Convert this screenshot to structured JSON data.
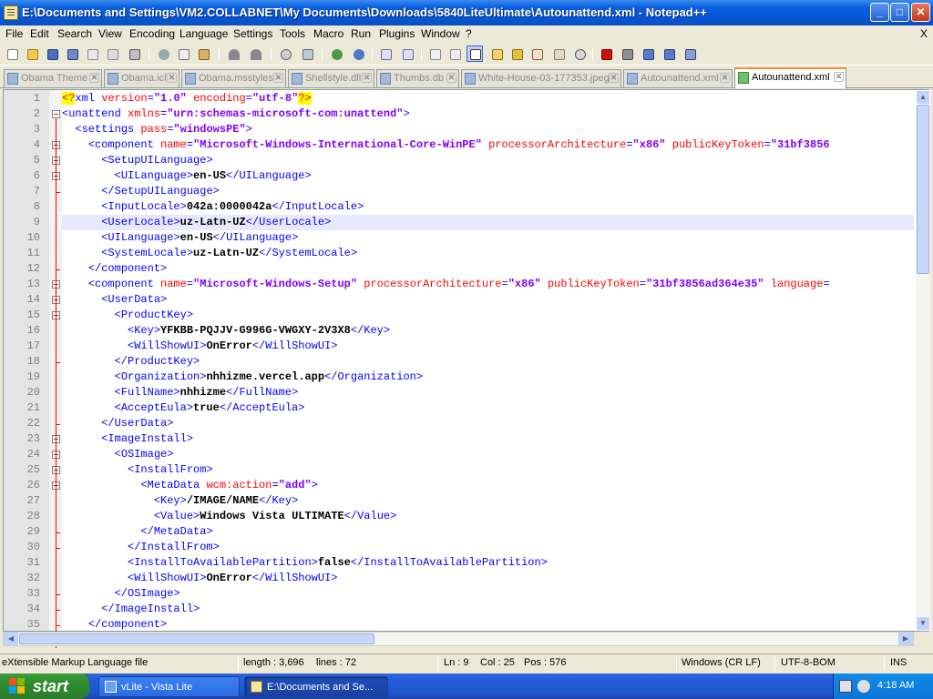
{
  "window": {
    "title": "E:\\Documents and Settings\\VM2.COLLABNET\\My Documents\\Downloads\\5840LiteUltimate\\Autounattend.xml - Notepad++"
  },
  "caption_buttons": {
    "minimize": "_",
    "maximize": "□",
    "close": "✕"
  },
  "menu": [
    "File",
    "Edit",
    "Search",
    "View",
    "Encoding",
    "Language",
    "Settings",
    "Tools",
    "Macro",
    "Run",
    "Plugins",
    "Window",
    "?"
  ],
  "menu_close": "X",
  "tabs": [
    {
      "label": "Obama Theme",
      "active": false
    },
    {
      "label": "Obama.icl",
      "active": false
    },
    {
      "label": "Obama.msstyles",
      "active": false
    },
    {
      "label": "Shellstyle.dll",
      "active": false
    },
    {
      "label": "Thumbs.db",
      "active": false
    },
    {
      "label": "White-House-03-177353.jpeg",
      "active": false
    },
    {
      "label": "Autounattend.xml",
      "active": false
    },
    {
      "label": "Autounattend.xml",
      "active": true
    }
  ],
  "editor": {
    "current_line": 9,
    "lines": [
      {
        "n": "1",
        "t": [
          [
            "pi",
            "<?"
          ],
          [
            "tg",
            "xml "
          ],
          [
            "at",
            "version"
          ],
          [
            "br",
            "="
          ],
          [
            "va",
            "\"1.0\""
          ],
          [
            "tg",
            " "
          ],
          [
            "at",
            "encoding"
          ],
          [
            "br",
            "="
          ],
          [
            "va",
            "\"utf-8\""
          ],
          [
            "pi",
            "?>"
          ]
        ]
      },
      {
        "n": "2",
        "t": [
          [
            "br",
            "<"
          ],
          [
            "tg",
            "unattend "
          ],
          [
            "at",
            "xmlns"
          ],
          [
            "br",
            "="
          ],
          [
            "va",
            "\"urn:schemas-microsoft-com:unattend\""
          ],
          [
            "br",
            ">"
          ]
        ]
      },
      {
        "n": "3",
        "t": [
          [
            "tx",
            "  "
          ],
          [
            "br",
            "<"
          ],
          [
            "tg",
            "settings "
          ],
          [
            "at",
            "pass"
          ],
          [
            "br",
            "="
          ],
          [
            "va",
            "\"windowsPE\""
          ],
          [
            "br",
            ">"
          ]
        ]
      },
      {
        "n": "4",
        "t": [
          [
            "tx",
            "    "
          ],
          [
            "br",
            "<"
          ],
          [
            "tg",
            "component "
          ],
          [
            "at",
            "name"
          ],
          [
            "br",
            "="
          ],
          [
            "va",
            "\"Microsoft-Windows-International-Core-WinPE\""
          ],
          [
            "tg",
            " "
          ],
          [
            "at",
            "processorArchitecture"
          ],
          [
            "br",
            "="
          ],
          [
            "va",
            "\"x86\""
          ],
          [
            "tg",
            " "
          ],
          [
            "at",
            "publicKeyToken"
          ],
          [
            "br",
            "="
          ],
          [
            "va",
            "\"31bf3856"
          ]
        ]
      },
      {
        "n": "5",
        "t": [
          [
            "tx",
            "      "
          ],
          [
            "br",
            "<"
          ],
          [
            "tg",
            "SetupUILanguage"
          ],
          [
            "br",
            ">"
          ]
        ]
      },
      {
        "n": "6",
        "t": [
          [
            "tx",
            "        "
          ],
          [
            "br",
            "<"
          ],
          [
            "tg",
            "UILanguage"
          ],
          [
            "br",
            ">"
          ],
          [
            "tx",
            "en-US"
          ],
          [
            "br",
            "</"
          ],
          [
            "tg",
            "UILanguage"
          ],
          [
            "br",
            ">"
          ]
        ]
      },
      {
        "n": "7",
        "t": [
          [
            "tx",
            "      "
          ],
          [
            "br",
            "</"
          ],
          [
            "tg",
            "SetupUILanguage"
          ],
          [
            "br",
            ">"
          ]
        ]
      },
      {
        "n": "8",
        "t": [
          [
            "tx",
            "      "
          ],
          [
            "br",
            "<"
          ],
          [
            "tg",
            "InputLocale"
          ],
          [
            "br",
            ">"
          ],
          [
            "tx",
            "042a:0000042a"
          ],
          [
            "br",
            "</"
          ],
          [
            "tg",
            "InputLocale"
          ],
          [
            "br",
            ">"
          ]
        ]
      },
      {
        "n": "9",
        "t": [
          [
            "tx",
            "      "
          ],
          [
            "br",
            "<"
          ],
          [
            "tg",
            "UserLocale"
          ],
          [
            "br",
            ">"
          ],
          [
            "tx",
            "uz-Latn-UZ"
          ],
          [
            "br",
            "</"
          ],
          [
            "tg",
            "UserLocale"
          ],
          [
            "br",
            ">"
          ]
        ]
      },
      {
        "n": "10",
        "t": [
          [
            "tx",
            "      "
          ],
          [
            "br",
            "<"
          ],
          [
            "tg",
            "UILanguage"
          ],
          [
            "br",
            ">"
          ],
          [
            "tx",
            "en-US"
          ],
          [
            "br",
            "</"
          ],
          [
            "tg",
            "UILanguage"
          ],
          [
            "br",
            ">"
          ]
        ]
      },
      {
        "n": "11",
        "t": [
          [
            "tx",
            "      "
          ],
          [
            "br",
            "<"
          ],
          [
            "tg",
            "SystemLocale"
          ],
          [
            "br",
            ">"
          ],
          [
            "tx",
            "uz-Latn-UZ"
          ],
          [
            "br",
            "</"
          ],
          [
            "tg",
            "SystemLocale"
          ],
          [
            "br",
            ">"
          ]
        ]
      },
      {
        "n": "12",
        "t": [
          [
            "tx",
            "    "
          ],
          [
            "br",
            "</"
          ],
          [
            "tg",
            "component"
          ],
          [
            "br",
            ">"
          ]
        ]
      },
      {
        "n": "13",
        "t": [
          [
            "tx",
            "    "
          ],
          [
            "br",
            "<"
          ],
          [
            "tg",
            "component "
          ],
          [
            "at",
            "name"
          ],
          [
            "br",
            "="
          ],
          [
            "va",
            "\"Microsoft-Windows-Setup\""
          ],
          [
            "tg",
            " "
          ],
          [
            "at",
            "processorArchitecture"
          ],
          [
            "br",
            "="
          ],
          [
            "va",
            "\"x86\""
          ],
          [
            "tg",
            " "
          ],
          [
            "at",
            "publicKeyToken"
          ],
          [
            "br",
            "="
          ],
          [
            "va",
            "\"31bf3856ad364e35\""
          ],
          [
            "tg",
            " "
          ],
          [
            "at",
            "language"
          ],
          [
            "br",
            "="
          ]
        ]
      },
      {
        "n": "14",
        "t": [
          [
            "tx",
            "      "
          ],
          [
            "br",
            "<"
          ],
          [
            "tg",
            "UserData"
          ],
          [
            "br",
            ">"
          ]
        ]
      },
      {
        "n": "15",
        "t": [
          [
            "tx",
            "        "
          ],
          [
            "br",
            "<"
          ],
          [
            "tg",
            "ProductKey"
          ],
          [
            "br",
            ">"
          ]
        ]
      },
      {
        "n": "16",
        "t": [
          [
            "tx",
            "          "
          ],
          [
            "br",
            "<"
          ],
          [
            "tg",
            "Key"
          ],
          [
            "br",
            ">"
          ],
          [
            "tx",
            "YFKBB-PQJJV-G996G-VWGXY-2V3X8"
          ],
          [
            "br",
            "</"
          ],
          [
            "tg",
            "Key"
          ],
          [
            "br",
            ">"
          ]
        ]
      },
      {
        "n": "17",
        "t": [
          [
            "tx",
            "          "
          ],
          [
            "br",
            "<"
          ],
          [
            "tg",
            "WillShowUI"
          ],
          [
            "br",
            ">"
          ],
          [
            "tx",
            "OnError"
          ],
          [
            "br",
            "</"
          ],
          [
            "tg",
            "WillShowUI"
          ],
          [
            "br",
            ">"
          ]
        ]
      },
      {
        "n": "18",
        "t": [
          [
            "tx",
            "        "
          ],
          [
            "br",
            "</"
          ],
          [
            "tg",
            "ProductKey"
          ],
          [
            "br",
            ">"
          ]
        ]
      },
      {
        "n": "19",
        "t": [
          [
            "tx",
            "        "
          ],
          [
            "br",
            "<"
          ],
          [
            "tg",
            "Organization"
          ],
          [
            "br",
            ">"
          ],
          [
            "tx",
            "nhhizme.vercel.app"
          ],
          [
            "br",
            "</"
          ],
          [
            "tg",
            "Organization"
          ],
          [
            "br",
            ">"
          ]
        ]
      },
      {
        "n": "20",
        "t": [
          [
            "tx",
            "        "
          ],
          [
            "br",
            "<"
          ],
          [
            "tg",
            "FullName"
          ],
          [
            "br",
            ">"
          ],
          [
            "tx",
            "nhhizme"
          ],
          [
            "br",
            "</"
          ],
          [
            "tg",
            "FullName"
          ],
          [
            "br",
            ">"
          ]
        ]
      },
      {
        "n": "21",
        "t": [
          [
            "tx",
            "        "
          ],
          [
            "br",
            "<"
          ],
          [
            "tg",
            "AcceptEula"
          ],
          [
            "br",
            ">"
          ],
          [
            "tx",
            "true"
          ],
          [
            "br",
            "</"
          ],
          [
            "tg",
            "AcceptEula"
          ],
          [
            "br",
            ">"
          ]
        ]
      },
      {
        "n": "22",
        "t": [
          [
            "tx",
            "      "
          ],
          [
            "br",
            "</"
          ],
          [
            "tg",
            "UserData"
          ],
          [
            "br",
            ">"
          ]
        ]
      },
      {
        "n": "23",
        "t": [
          [
            "tx",
            "      "
          ],
          [
            "br",
            "<"
          ],
          [
            "tg",
            "ImageInstall"
          ],
          [
            "br",
            ">"
          ]
        ]
      },
      {
        "n": "24",
        "t": [
          [
            "tx",
            "        "
          ],
          [
            "br",
            "<"
          ],
          [
            "tg",
            "OSImage"
          ],
          [
            "br",
            ">"
          ]
        ]
      },
      {
        "n": "25",
        "t": [
          [
            "tx",
            "          "
          ],
          [
            "br",
            "<"
          ],
          [
            "tg",
            "InstallFrom"
          ],
          [
            "br",
            ">"
          ]
        ]
      },
      {
        "n": "26",
        "t": [
          [
            "tx",
            "            "
          ],
          [
            "br",
            "<"
          ],
          [
            "tg",
            "MetaData "
          ],
          [
            "at",
            "wcm:action"
          ],
          [
            "br",
            "="
          ],
          [
            "va",
            "\"add\""
          ],
          [
            "br",
            ">"
          ]
        ]
      },
      {
        "n": "27",
        "t": [
          [
            "tx",
            "              "
          ],
          [
            "br",
            "<"
          ],
          [
            "tg",
            "Key"
          ],
          [
            "br",
            ">"
          ],
          [
            "tx",
            "/IMAGE/NAME"
          ],
          [
            "br",
            "</"
          ],
          [
            "tg",
            "Key"
          ],
          [
            "br",
            ">"
          ]
        ]
      },
      {
        "n": "28",
        "t": [
          [
            "tx",
            "              "
          ],
          [
            "br",
            "<"
          ],
          [
            "tg",
            "Value"
          ],
          [
            "br",
            ">"
          ],
          [
            "tx",
            "Windows Vista ULTIMATE"
          ],
          [
            "br",
            "</"
          ],
          [
            "tg",
            "Value"
          ],
          [
            "br",
            ">"
          ]
        ]
      },
      {
        "n": "29",
        "t": [
          [
            "tx",
            "            "
          ],
          [
            "br",
            "</"
          ],
          [
            "tg",
            "MetaData"
          ],
          [
            "br",
            ">"
          ]
        ]
      },
      {
        "n": "30",
        "t": [
          [
            "tx",
            "          "
          ],
          [
            "br",
            "</"
          ],
          [
            "tg",
            "InstallFrom"
          ],
          [
            "br",
            ">"
          ]
        ]
      },
      {
        "n": "31",
        "t": [
          [
            "tx",
            "          "
          ],
          [
            "br",
            "<"
          ],
          [
            "tg",
            "InstallToAvailablePartition"
          ],
          [
            "br",
            ">"
          ],
          [
            "tx",
            "false"
          ],
          [
            "br",
            "</"
          ],
          [
            "tg",
            "InstallToAvailablePartition"
          ],
          [
            "br",
            ">"
          ]
        ]
      },
      {
        "n": "32",
        "t": [
          [
            "tx",
            "          "
          ],
          [
            "br",
            "<"
          ],
          [
            "tg",
            "WillShowUI"
          ],
          [
            "br",
            ">"
          ],
          [
            "tx",
            "OnError"
          ],
          [
            "br",
            "</"
          ],
          [
            "tg",
            "WillShowUI"
          ],
          [
            "br",
            ">"
          ]
        ]
      },
      {
        "n": "33",
        "t": [
          [
            "tx",
            "        "
          ],
          [
            "br",
            "</"
          ],
          [
            "tg",
            "OSImage"
          ],
          [
            "br",
            ">"
          ]
        ]
      },
      {
        "n": "34",
        "t": [
          [
            "tx",
            "      "
          ],
          [
            "br",
            "</"
          ],
          [
            "tg",
            "ImageInstall"
          ],
          [
            "br",
            ">"
          ]
        ]
      },
      {
        "n": "35",
        "t": [
          [
            "tx",
            "    "
          ],
          [
            "br",
            "</"
          ],
          [
            "tg",
            "component"
          ],
          [
            "br",
            ">"
          ]
        ]
      }
    ]
  },
  "status": {
    "filetype": "eXtensible Markup Language file",
    "length": "length : 3,696",
    "lines": "lines : 72",
    "ln": "Ln : 9",
    "col": "Col : 25",
    "pos": "Pos : 576",
    "eol": "Windows (CR LF)",
    "encoding": "UTF-8-BOM",
    "mode": "INS"
  },
  "taskbar": {
    "start": "start",
    "tasks": [
      {
        "label": "vLite - Vista Lite",
        "active": false
      },
      {
        "label": "E:\\Documents and Se...",
        "active": true
      }
    ],
    "clock": "4:18 AM"
  },
  "colors": {
    "tag": "#0000ff",
    "attr": "#ff0000",
    "value": "#8000ff",
    "pi_bg": "#ffff00",
    "current_line": "#e8e8ff",
    "titlebar": "#0456d4",
    "start_green": "#2e8b2e"
  }
}
